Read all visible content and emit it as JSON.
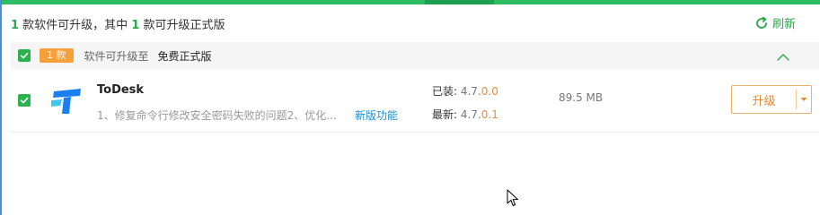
{
  "summary": {
    "count1": "1",
    "text1": " 款软件可升级，其中 ",
    "count2": "1",
    "text2": " 款可升级正式版"
  },
  "refresh": {
    "label": "刷新"
  },
  "group": {
    "badge": "1 款",
    "text": "软件可升级至",
    "target": "免费正式版"
  },
  "app": {
    "name": "ToDesk",
    "description": "1、修复命令行修改安全密码失败的问题2、优化...",
    "new_features": "新版功能",
    "installed_label": "已装:",
    "installed_version_main": " 4.7.",
    "installed_version_hi": "0.0",
    "latest_label": "最新:",
    "latest_version_main": " 4.7.",
    "latest_version_hi": "0.1",
    "size": "89.5 MB",
    "upgrade_label": "升级"
  },
  "colors": {
    "accent_green": "#2aa84a",
    "badge_orange": "#f6a03c",
    "upgrade_orange": "#e8892f",
    "link_blue": "#1a8fd3"
  },
  "icons": {
    "refresh": "refresh-icon",
    "check": "check-icon",
    "collapse": "chevron-up-icon",
    "app": "todesk-logo-icon",
    "dropdown": "caret-down-icon",
    "cursor": "mouse-cursor-icon"
  }
}
